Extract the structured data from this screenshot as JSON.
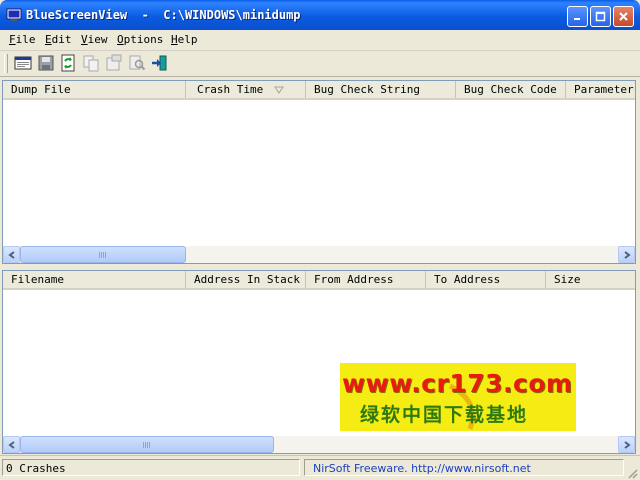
{
  "window": {
    "title": "BlueScreenView  -  C:\\WINDOWS\\minidump"
  },
  "menu": {
    "items": [
      {
        "label": "File",
        "accel": "F",
        "rest": "ile"
      },
      {
        "label": "Edit",
        "accel": "E",
        "rest": "dit"
      },
      {
        "label": "View",
        "accel": "V",
        "rest": "iew"
      },
      {
        "label": "Options",
        "accel": "O",
        "rest": "ptions"
      },
      {
        "label": "Help",
        "accel": "H",
        "rest": "elp"
      }
    ]
  },
  "toolbar": {
    "buttons": [
      "html-report-icon",
      "save-icon",
      "refresh-icon",
      "copy-icon",
      "properties-icon",
      "find-icon",
      "exit-icon"
    ]
  },
  "upper_list": {
    "columns": [
      "Dump File",
      "Crash Time",
      "Bug Check String",
      "Bug Check Code",
      "Parameter"
    ],
    "sorted_column": "Crash Time"
  },
  "lower_list": {
    "columns": [
      "Filename",
      "Address In Stack",
      "From Address",
      "To Address",
      "Size"
    ]
  },
  "watermark": {
    "url": "www.cr173.com",
    "caption": "绿软中国下载基地"
  },
  "status": {
    "crash_count": "0 Crashes",
    "credit": "NirSoft Freeware.  http://www.nirsoft.net"
  },
  "colors": {
    "title_bar": "#0a5fe8",
    "status_link": "#1b3fbf",
    "watermark_bg": "#f4ec12"
  }
}
